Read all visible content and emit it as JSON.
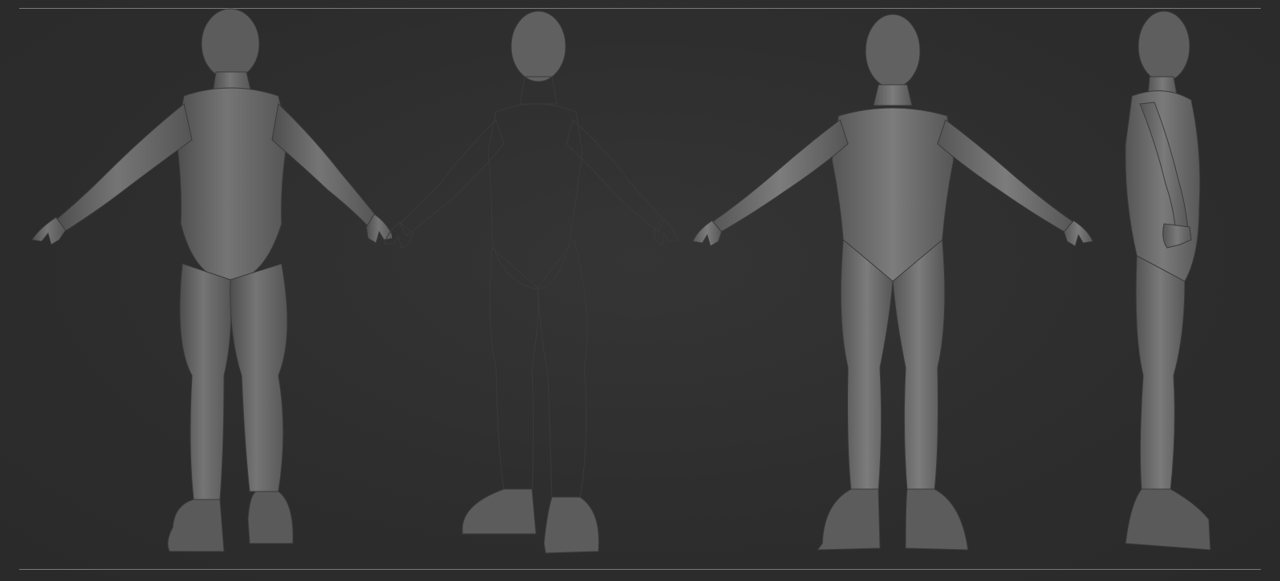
{
  "scene": {
    "background_color": "#2d2d2d",
    "rule_color": "#7a7a7a",
    "model_color": "#6e6e6e",
    "views": [
      {
        "view": "back",
        "icon": "back-view-figure-icon"
      },
      {
        "view": "three-quarter",
        "icon": "three-quarter-view-figure-icon"
      },
      {
        "view": "front",
        "icon": "front-view-figure-icon"
      },
      {
        "view": "side",
        "icon": "side-view-figure-icon"
      }
    ]
  }
}
